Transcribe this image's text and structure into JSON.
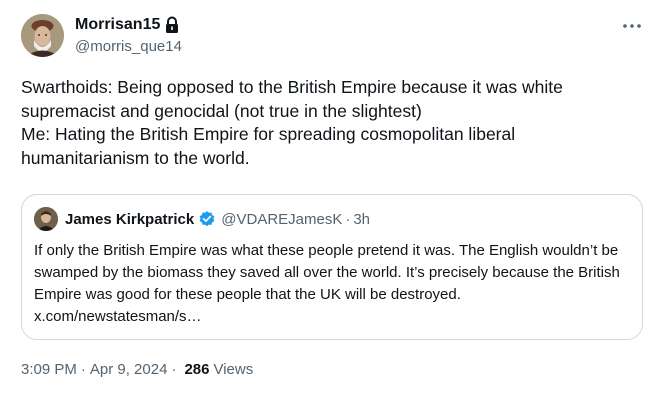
{
  "author": {
    "display_name": "Morrisan15",
    "handle": "@morris_que14",
    "avatar_icon": "portrait-avatar",
    "protected_icon": "lock-icon"
  },
  "tweet": {
    "text": "Swarthoids: Being opposed to the British Empire because it was white supremacist and genocidal (not true in the slightest)\nMe: Hating the British Empire for spreading cosmopolitan liberal humanitarianism to the world."
  },
  "quote": {
    "display_name": "James Kirkpatrick",
    "handle": "@VDAREJamesK",
    "separator": "·",
    "time": "3h",
    "text": "If only the British Empire was what these people pretend it was. The English wouldn’t be swamped by the biomass they saved all over the world. It’s precisely because the British Empire was good for these people that the UK will be destroyed. x.com/newstatesman/s…",
    "verified_color": "#1d9bf0"
  },
  "meta": {
    "time": "3:09 PM",
    "separator": "·",
    "date": "Apr 9, 2024",
    "separator2": "·",
    "views_count": "286",
    "views_label": "Views"
  },
  "colors": {
    "text_primary": "#0f1419",
    "text_secondary": "#536471",
    "border": "#cfd9de"
  }
}
